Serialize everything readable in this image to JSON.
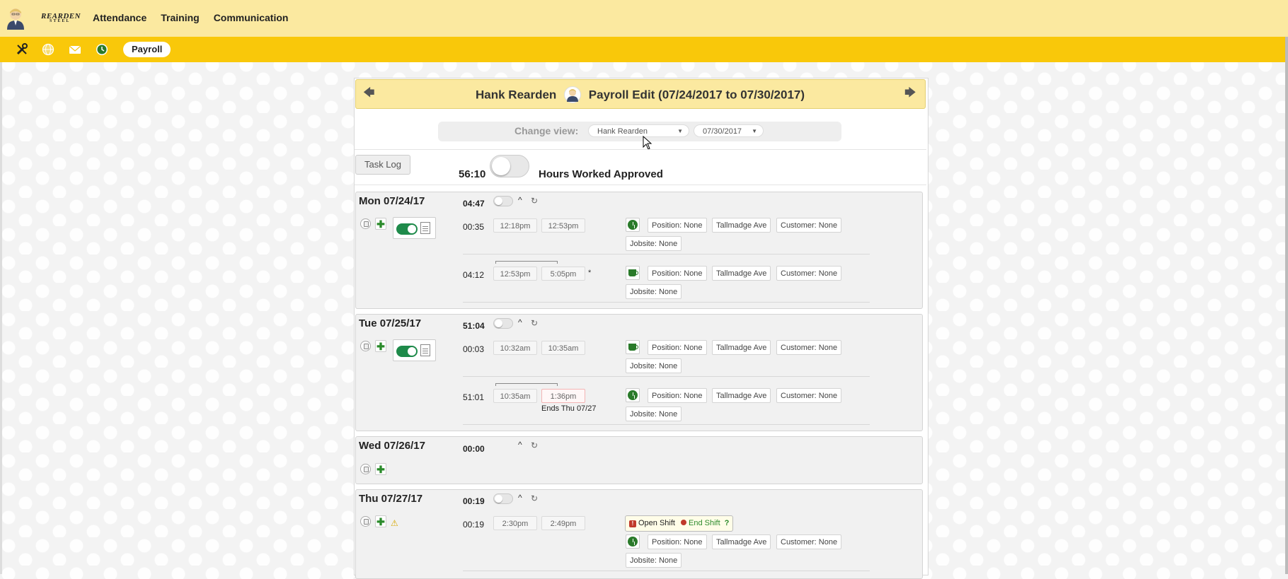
{
  "nav": {
    "brand": "REARDEN",
    "brand_sub": "STEEL",
    "items": [
      "Attendance",
      "Training",
      "Communication"
    ]
  },
  "subnav": {
    "icons": [
      "tools-icon",
      "globe-icon",
      "mail-icon",
      "clock-icon"
    ],
    "active_tab": "Payroll"
  },
  "header": {
    "employee": "Hank Rearden",
    "title": "Payroll Edit (07/24/2017 to 07/30/2017)",
    "prev_arrow": "🡄",
    "next_arrow": "🡆"
  },
  "change_view": {
    "label": "Change view:",
    "employee_select": "Hank Rearden",
    "date_select": "07/30/2017"
  },
  "summary": {
    "task_log": "Task Log",
    "total_hours": "56:10",
    "approved_label": "Hours Worked Approved"
  },
  "tags": {
    "position": "Position: None",
    "location": "Tallmadge Ave",
    "customer": "Customer: None",
    "jobsite": "Jobsite: None"
  },
  "days": [
    {
      "label": "Mon 07/24/17",
      "total": "04:47",
      "entries": [
        {
          "duration": "00:35",
          "start": "12:18pm",
          "end": "12:53pm",
          "type": "clock"
        },
        {
          "duration": "04:12",
          "start": "12:53pm",
          "end": "5:05pm",
          "type": "break",
          "mark": "*"
        }
      ]
    },
    {
      "label": "Tue 07/25/17",
      "total": "51:04",
      "entries": [
        {
          "duration": "00:03",
          "start": "10:32am",
          "end": "10:35am",
          "type": "break"
        },
        {
          "duration": "51:01",
          "start": "10:35am",
          "end": "1:36pm",
          "type": "clock",
          "note": "Ends Thu 07/27"
        }
      ]
    },
    {
      "label": "Wed 07/26/17",
      "total": "00:00",
      "entries": []
    },
    {
      "label": "Thu 07/27/17",
      "total": "00:19",
      "entries": [
        {
          "duration": "00:19",
          "start": "2:30pm",
          "end": "2:49pm",
          "type": "clock"
        }
      ],
      "open_shift": {
        "label": "Open Shift",
        "end_label": "End Shift",
        "help": "?"
      }
    }
  ],
  "colors": {
    "top_bar": "#fbe9a0",
    "sub_bar": "#f9c80a",
    "toggle_on": "#1e8a4a"
  }
}
